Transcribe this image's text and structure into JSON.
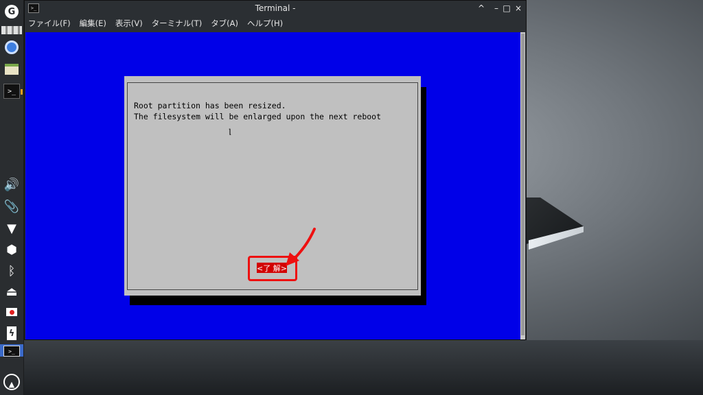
{
  "window": {
    "title": "Terminal -",
    "controls": {
      "pin": "^",
      "minimize": "–",
      "maximize": "□",
      "close": "×"
    },
    "menu": [
      "ファイル(F)",
      "編集(E)",
      "表示(V)",
      "ターミナル(T)",
      "タブ(A)",
      "ヘルプ(H)"
    ]
  },
  "dialog": {
    "message_line1": "Root partition has been resized.",
    "message_line2": "The filesystem will be enlarged upon the next reboot",
    "ok_label": "<了 解>"
  },
  "colors": {
    "terminal_bg": "#0000e8",
    "dialog_bg": "#c0c0c0",
    "ok_button": "#d20000",
    "annotation": "#ee1010"
  },
  "panel_icons": [
    "menu-icon",
    "chrome-icon",
    "files-icon",
    "terminal-icon",
    "volume-icon",
    "clip-icon",
    "wifi-icon",
    "cube-icon",
    "bluetooth-icon",
    "eject-icon",
    "record-icon",
    "battery-icon",
    "taskbar-terminal",
    "logo-icon"
  ]
}
